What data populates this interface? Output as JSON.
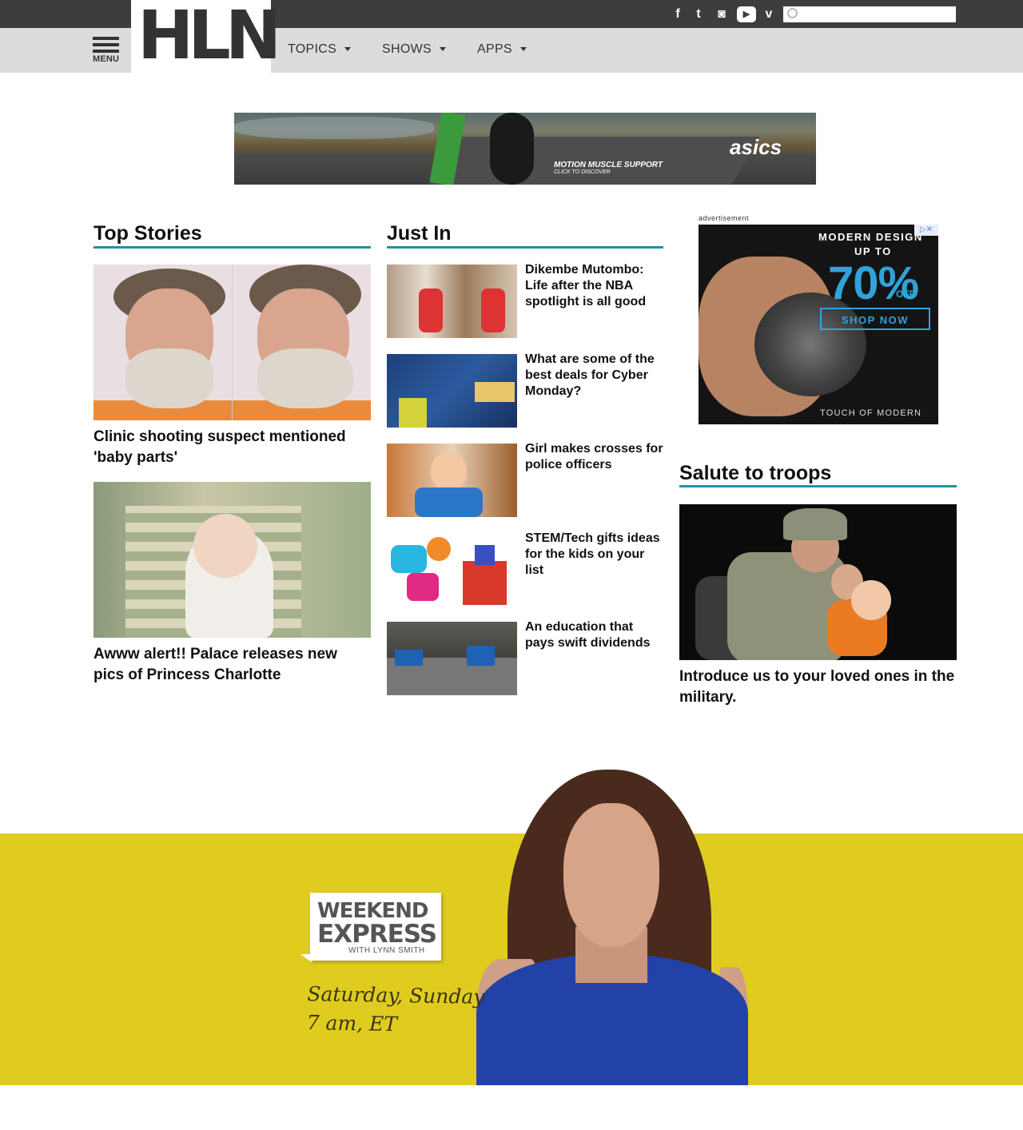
{
  "header": {
    "logo": "HLN",
    "menu_label": "MENU",
    "nav": [
      {
        "label": "TOPICS"
      },
      {
        "label": "SHOWS"
      },
      {
        "label": "APPS"
      }
    ],
    "social": [
      {
        "icon": "facebook-icon",
        "glyph": "f"
      },
      {
        "icon": "twitter-icon",
        "glyph": "t"
      },
      {
        "icon": "instagram-icon",
        "glyph": "◙"
      },
      {
        "icon": "youtube-icon",
        "glyph": "▶"
      },
      {
        "icon": "vine-icon",
        "glyph": "v"
      }
    ],
    "search_placeholder": ""
  },
  "banner_ad": {
    "tagline": "MOTION MUSCLE SUPPORT",
    "subtag": "CLICK TO DISCOVER",
    "brand": "asics"
  },
  "top_stories": {
    "title": "Top Stories",
    "items": [
      {
        "headline": "Clinic shooting suspect mentioned 'baby parts'"
      },
      {
        "headline": "Awww alert!! Palace releases new pics of Princess Charlotte"
      }
    ]
  },
  "just_in": {
    "title": "Just In",
    "items": [
      {
        "headline": "Dikembe Mutombo: Life after the NBA spotlight is all good"
      },
      {
        "headline": "What are some of the best deals for Cyber Monday?"
      },
      {
        "headline": "Girl makes crosses for police officers"
      },
      {
        "headline": "STEM/Tech gifts ideas for the kids on your list"
      },
      {
        "headline": "An education that pays swift dividends"
      }
    ]
  },
  "side_ad": {
    "label": "advertisement",
    "line1": "MODERN DESIGN",
    "line2": "UP TO",
    "percent": "70%",
    "off": "OFF",
    "button": "SHOP NOW",
    "footer": "TOUCH OF MODERN",
    "adchoice": "▷✕"
  },
  "salute": {
    "title": "Salute to troops",
    "headline": "Introduce us to your loved ones in the military."
  },
  "promo": {
    "show_line1": "WEEKEND",
    "show_line2": "EXPRESS",
    "host_line": "WITH LYNN SMITH",
    "days": "Saturday, Sunday",
    "time": "7 am, ET"
  },
  "colors": {
    "accent_rule": "#2a8ea3",
    "promo_yellow": "#e0cc1f",
    "topbar": "#3d3d3f",
    "navbar": "#dcdcdc"
  }
}
